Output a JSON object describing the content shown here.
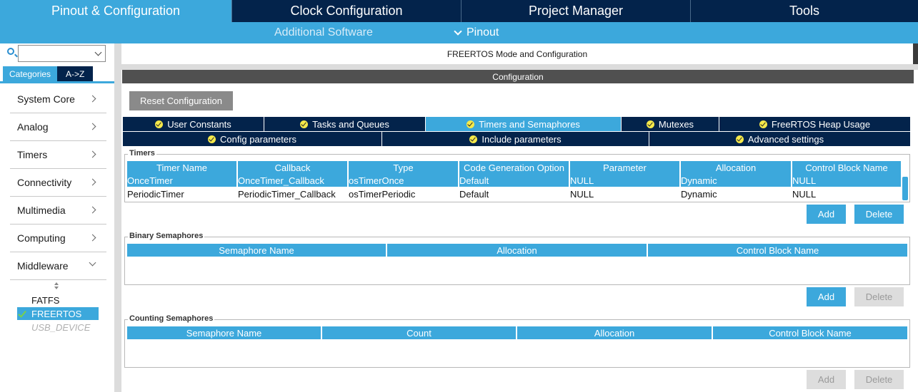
{
  "top_tabs": [
    {
      "label": "Pinout & Configuration"
    },
    {
      "label": "Clock Configuration"
    },
    {
      "label": "Project Manager"
    },
    {
      "label": "Tools"
    }
  ],
  "sub_bar": {
    "additional": "Additional Software",
    "pinout": "Pinout"
  },
  "sidebar": {
    "search_value": "",
    "tabs": [
      "Categories",
      "A->Z"
    ],
    "categories": [
      "System Core",
      "Analog",
      "Timers",
      "Connectivity",
      "Multimedia",
      "Computing",
      "Middleware"
    ],
    "middleware_items": [
      "FATFS",
      "FREERTOS",
      "USB_DEVICE"
    ]
  },
  "mode_title": "FREERTOS Mode and Configuration",
  "config_header": "Configuration",
  "reset_button": "Reset Configuration",
  "param_tabs_row1": [
    "User Constants",
    "Tasks and Queues",
    "Timers and Semaphores",
    "Mutexes",
    "FreeRTOS Heap Usage"
  ],
  "param_tabs_row2": [
    "Config parameters",
    "Include parameters",
    "Advanced settings"
  ],
  "timers": {
    "title": "Timers",
    "columns": [
      "Timer Name",
      "Callback",
      "Type",
      "Code Generation Option",
      "Parameter",
      "Allocation",
      "Control Block Name"
    ],
    "rows": [
      [
        "OnceTimer",
        "OnceTimer_Callback",
        "osTimerOnce",
        "Default",
        "NULL",
        "Dynamic",
        "NULL"
      ],
      [
        "PeriodicTimer",
        "PeriodicTimer_Callback",
        "osTimerPeriodic",
        "Default",
        "NULL",
        "Dynamic",
        "NULL"
      ]
    ],
    "add": "Add",
    "delete": "Delete"
  },
  "binary_semaphores": {
    "title": "Binary Semaphores",
    "columns": [
      "Semaphore Name",
      "Allocation",
      "Control Block Name"
    ],
    "add": "Add",
    "delete": "Delete"
  },
  "counting_semaphores": {
    "title": "Counting Semaphores",
    "columns": [
      "Semaphore Name",
      "Count",
      "Allocation",
      "Control Block Name"
    ],
    "add": "Add",
    "delete": "Delete"
  }
}
